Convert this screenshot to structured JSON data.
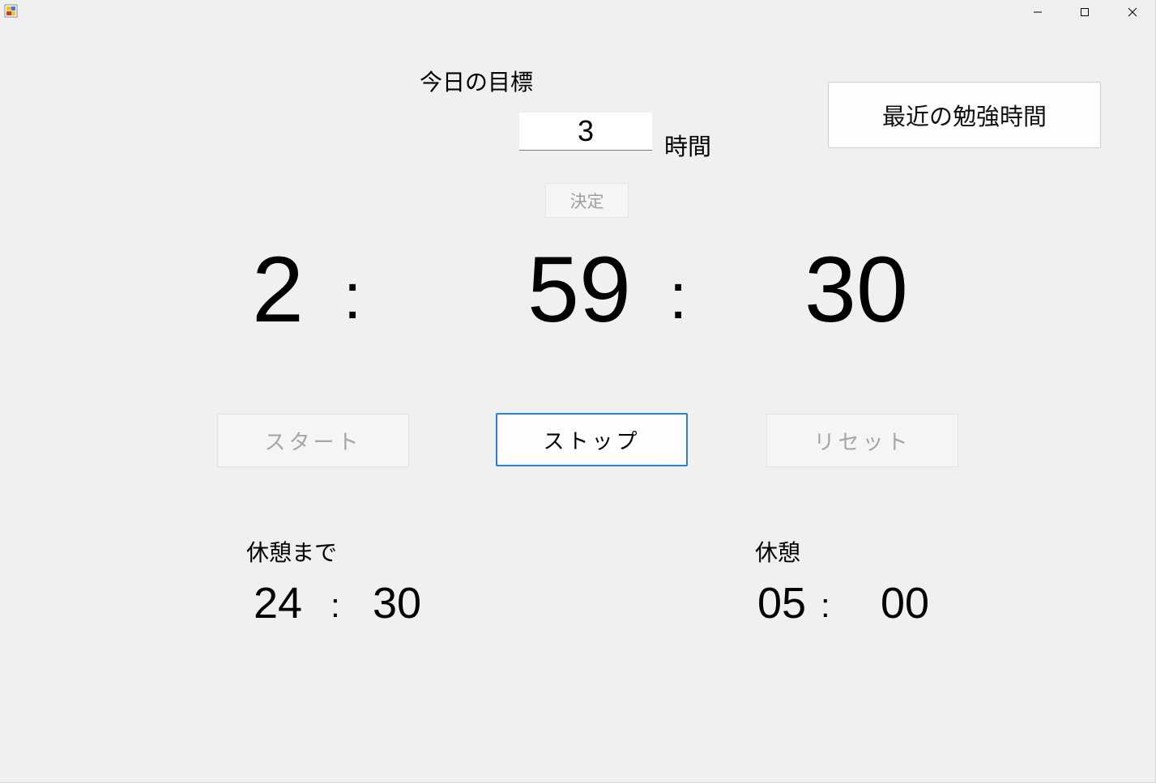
{
  "window": {
    "controls": {
      "minimize_icon": "minimize-icon",
      "maximize_icon": "maximize-icon",
      "close_icon": "close-icon"
    }
  },
  "goal": {
    "label": "今日の目標",
    "hours_value": "3",
    "unit": "時間",
    "decide_label": "決定"
  },
  "recent": {
    "button_label": "最近の勉強時間"
  },
  "timer": {
    "hours": "2",
    "sep1": ":",
    "minutes": "59",
    "sep2": ":",
    "seconds": "30"
  },
  "controls": {
    "start_label": "スタート",
    "stop_label": "ストップ",
    "reset_label": "リセット"
  },
  "until_break": {
    "label": "休憩まで",
    "minutes": "24",
    "sep": ":",
    "seconds": "30"
  },
  "break": {
    "label": "休憩",
    "minutes": "05",
    "sep": ":",
    "seconds": "00"
  },
  "colors": {
    "background": "#f0f0f0",
    "accent_border": "#2b7fd6",
    "disabled_text": "#a6a6a6"
  }
}
